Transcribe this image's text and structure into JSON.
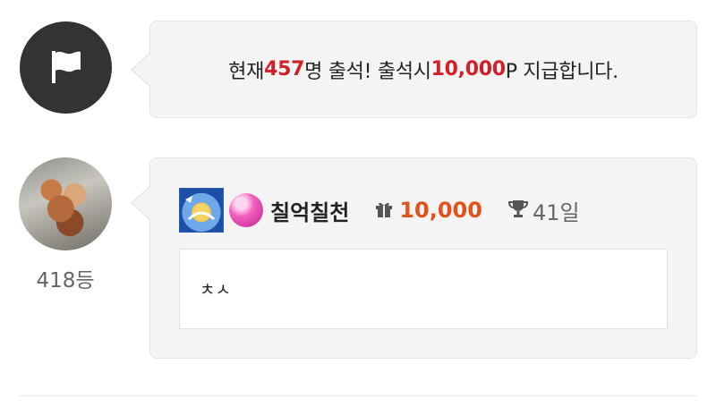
{
  "attendance": {
    "notice_prefix": "현재 ",
    "count": "457",
    "notice_middle": "명 출석! 출석시 ",
    "reward": "10,000",
    "notice_suffix": "P 지급합니다."
  },
  "entry": {
    "rank": "418등",
    "username": "칠억칠천",
    "points": "10,000",
    "days": "41일",
    "comment": "ㅊㅅ"
  },
  "colors": {
    "highlight_red": "#d0202a",
    "points_orange": "#e0531a",
    "bubble_bg": "#f4f4f4",
    "flag_avatar_bg": "#333333"
  },
  "icons": {
    "notice_icon": "flag-icon",
    "points_icon": "gift-icon",
    "days_icon": "trophy-icon"
  }
}
